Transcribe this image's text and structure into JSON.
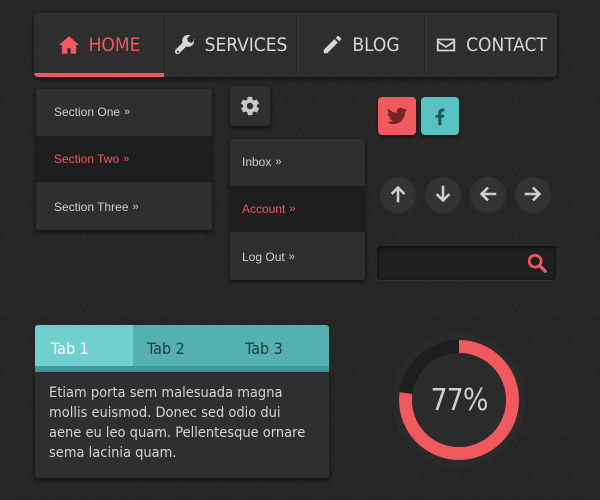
{
  "colors": {
    "accent": "#f0595d",
    "teal": "#58c2c3",
    "tab_active": "#70cfcf",
    "tab_inactive": "#55b1b1"
  },
  "nav": {
    "items": [
      {
        "label": "HOME",
        "icon": "home-icon",
        "active": true
      },
      {
        "label": "SERVICES",
        "icon": "wrench-icon",
        "active": false
      },
      {
        "label": "BLOG",
        "icon": "pencil-icon",
        "active": false
      },
      {
        "label": "CONTACT",
        "icon": "envelope-icon",
        "active": false
      }
    ]
  },
  "sections_menu": {
    "items": [
      {
        "label": "Section One",
        "chevron": "»",
        "active": false
      },
      {
        "label": "Section Two",
        "chevron": "»",
        "active": true
      },
      {
        "label": "Section Three",
        "chevron": "»",
        "active": false
      }
    ]
  },
  "settings_menu": {
    "icon": "gear-icon",
    "items": [
      {
        "label": "Inbox",
        "chevron": "»",
        "active": false
      },
      {
        "label": "Account",
        "chevron": "»",
        "active": true
      },
      {
        "label": "Log Out",
        "chevron": "»",
        "active": false
      }
    ]
  },
  "social": [
    {
      "icon": "twitter-icon",
      "color": "#f0595d"
    },
    {
      "icon": "facebook-icon",
      "color": "#58c2c3"
    }
  ],
  "arrows": [
    "arrow-up-icon",
    "arrow-down-icon",
    "arrow-left-icon",
    "arrow-right-icon"
  ],
  "search": {
    "value": "",
    "placeholder": "",
    "icon": "search-icon"
  },
  "tabs": {
    "items": [
      {
        "label": "Tab 1",
        "active": true
      },
      {
        "label": "Tab 2",
        "active": false
      },
      {
        "label": "Tab 3",
        "active": false
      }
    ],
    "content": "Etiam porta sem malesuada magna mollis euismod. Donec sed odio dui aene eu leo quam. Pellentesque ornare sema lacinia quam."
  },
  "progress": {
    "value": 77,
    "label": "77%"
  }
}
